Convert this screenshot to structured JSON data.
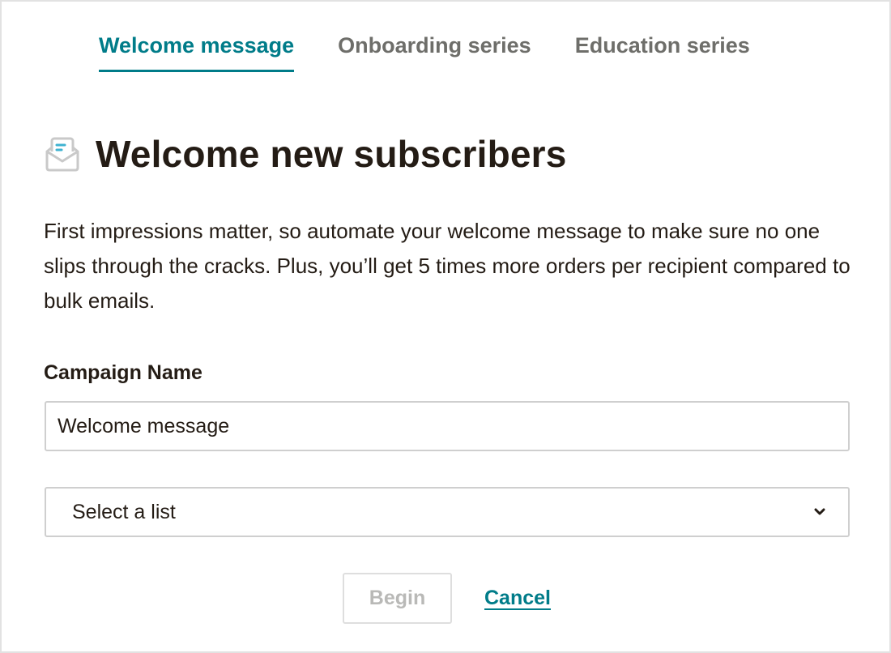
{
  "tabs": [
    {
      "label": "Welcome message",
      "active": true
    },
    {
      "label": "Onboarding series",
      "active": false
    },
    {
      "label": "Education series",
      "active": false
    }
  ],
  "heading": {
    "icon": "envelope-open-icon",
    "title": "Welcome new subscribers"
  },
  "description": "First impressions matter, so automate your welcome message to make sure no one slips through the cracks. Plus, you’ll get 5 times more orders per recipient compared to bulk emails.",
  "form": {
    "campaign_name_label": "Campaign Name",
    "campaign_name_value": "Welcome message",
    "list_select_value": "Select a list",
    "list_select_icon": "chevron-down-icon"
  },
  "actions": {
    "begin_label": "Begin",
    "begin_disabled": true,
    "cancel_label": "Cancel"
  },
  "colors": {
    "accent": "#007c89",
    "text": "#241c15",
    "tab_inactive": "#6e6e6a",
    "border": "#cfcfcf",
    "disabled_text": "#b9b9b7"
  }
}
